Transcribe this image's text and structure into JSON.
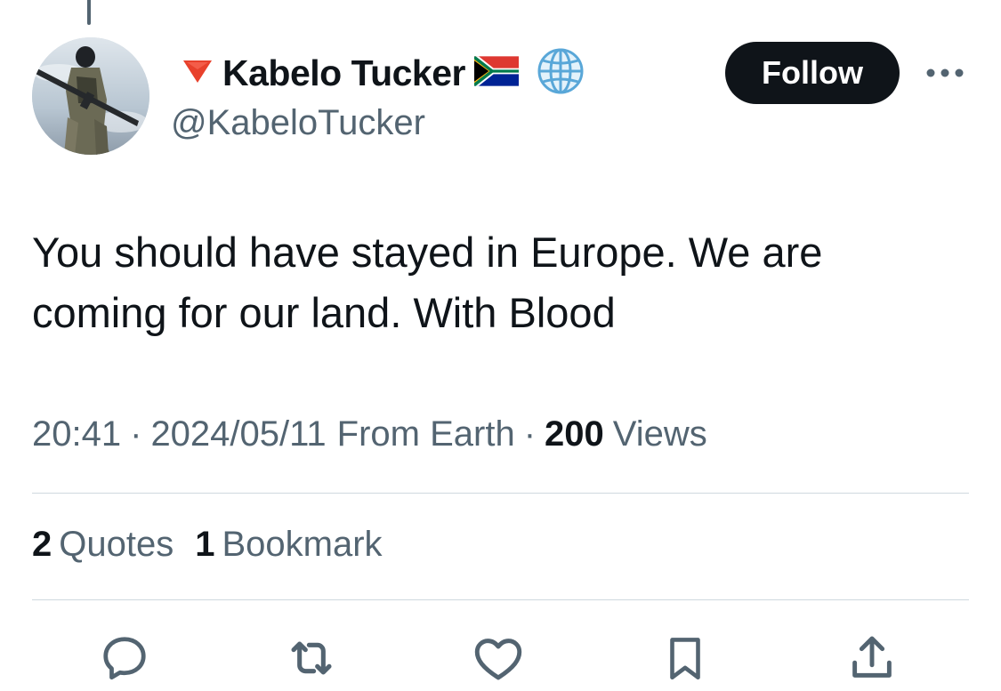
{
  "author": {
    "name": "Kabelo Tucker",
    "handle": "@KabeloTucker"
  },
  "header": {
    "follow_label": "Follow"
  },
  "tweet": {
    "text": "You should have stayed in Europe. We are coming for our land. With Blood",
    "time": "20:41",
    "date": "2024/05/11",
    "source": "From Earth",
    "views_count": "200",
    "views_label": "Views"
  },
  "stats": {
    "quotes_count": "2",
    "quotes_label": "Quotes",
    "bookmarks_count": "1",
    "bookmarks_label": "Bookmark"
  },
  "icons": {
    "avatar": "avatar-photo",
    "before_name": "red-triangle-down-icon",
    "after_name": "south-africa-flag-icon",
    "globe": "globe-icon",
    "more": "more-icon",
    "actions": [
      "reply-icon",
      "retweet-icon",
      "like-icon",
      "bookmark-icon",
      "share-icon"
    ]
  },
  "colors": {
    "text": "#0f1419",
    "secondary": "#536471",
    "divider": "#cfd9de",
    "follow_bg": "#0f1419",
    "triangle": "#e8412c"
  }
}
